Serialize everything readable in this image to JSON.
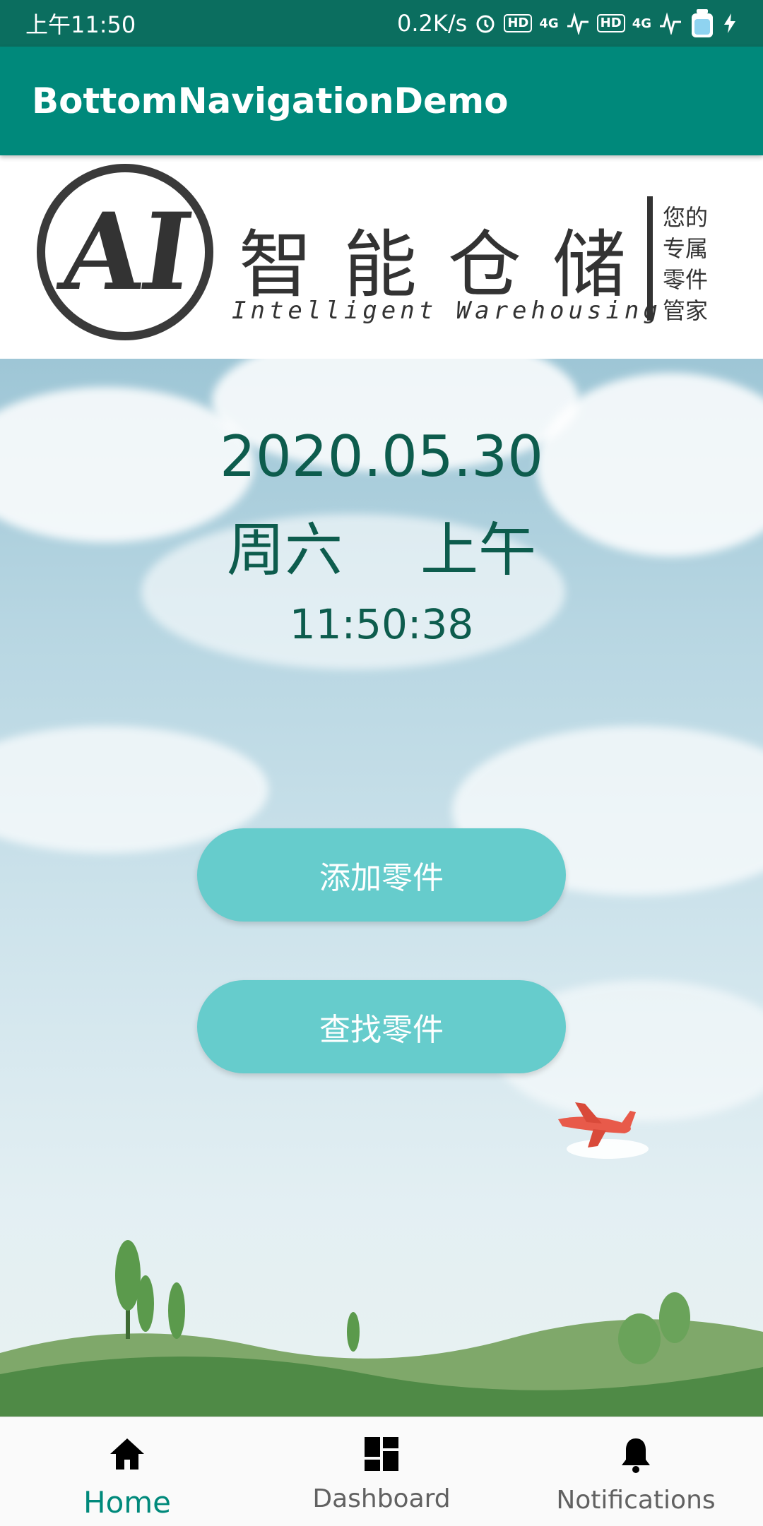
{
  "status_bar": {
    "time": "上午11:50",
    "net_speed": "0.2K/s",
    "hd_badge": "HD",
    "network": "4G"
  },
  "app_bar": {
    "title": "BottomNavigationDemo"
  },
  "banner": {
    "logo_text": "AI",
    "title": "智能仓储",
    "subtitle": "Intelligent Warehousing",
    "slogan": [
      "您的",
      "专属",
      "零件",
      "管家"
    ]
  },
  "home": {
    "date": "2020.05.30",
    "weekday": "周六",
    "period": "上午",
    "time": "11:50:38",
    "add_part_label": "添加零件",
    "find_part_label": "查找零件"
  },
  "bottom_nav": {
    "items": [
      {
        "label": "Home",
        "icon": "home-icon",
        "active": true
      },
      {
        "label": "Dashboard",
        "icon": "dashboard-icon",
        "active": false
      },
      {
        "label": "Notifications",
        "icon": "bell-icon",
        "active": false
      }
    ]
  },
  "colors": {
    "status_bar": "#0b6e5f",
    "app_bar": "#00897b",
    "button": "#66cccc",
    "date_text": "#0d5c4d",
    "nav_active": "#00897b"
  }
}
